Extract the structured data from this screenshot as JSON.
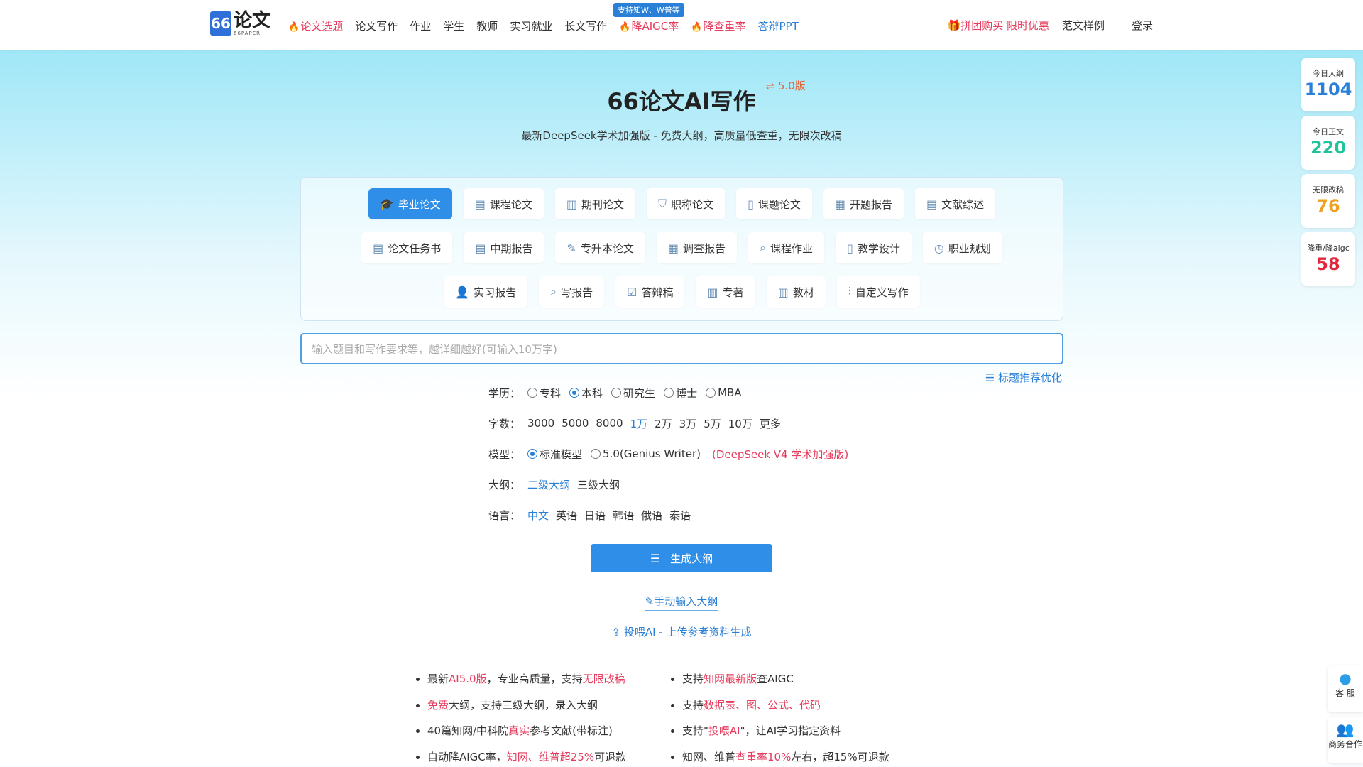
{
  "header": {
    "logo_num": "66",
    "logo_text": "论文",
    "logo_sub": "66PAPER",
    "nav": [
      {
        "label": "论文选题",
        "style": "hot",
        "flame": true
      },
      {
        "label": "论文写作",
        "style": "",
        "flame": false
      },
      {
        "label": "作业",
        "style": "",
        "flame": false
      },
      {
        "label": "学生",
        "style": "",
        "flame": false
      },
      {
        "label": "教师",
        "style": "",
        "flame": false
      },
      {
        "label": "实习就业",
        "style": "",
        "flame": false
      },
      {
        "label": "长文写作",
        "style": "",
        "flame": false
      },
      {
        "label": "降AIGC率",
        "style": "hot",
        "flame": true
      },
      {
        "label": "降查重率",
        "style": "hot",
        "flame": true
      },
      {
        "label": "答辩PPT",
        "style": "blue",
        "flame": false
      }
    ],
    "nav_badge": "支持知W、W普等",
    "promo": "拼团购买 限时优惠",
    "samples": "范文样例",
    "login": "登录"
  },
  "hero": {
    "title": "66论文AI写作",
    "version": "5.0版",
    "subtitle": "最新DeepSeek学术加强版 - 免费大纲，高质量低查重，无限次改稿"
  },
  "types": {
    "row1": [
      {
        "label": "毕业论文",
        "icon": "graduation-cap-icon",
        "glyph": "🎓",
        "active": true
      },
      {
        "label": "课程论文",
        "icon": "document-icon",
        "glyph": "▤",
        "active": false
      },
      {
        "label": "期刊论文",
        "icon": "journal-icon",
        "glyph": "▥",
        "active": false
      },
      {
        "label": "职称论文",
        "icon": "shield-icon",
        "glyph": "⛉",
        "active": false
      },
      {
        "label": "课题论文",
        "icon": "bookmark-icon",
        "glyph": "▯",
        "active": false
      },
      {
        "label": "开题报告",
        "icon": "report-icon",
        "glyph": "▦",
        "active": false
      },
      {
        "label": "文献综述",
        "icon": "document-icon",
        "glyph": "▤",
        "active": false
      }
    ],
    "row2": [
      {
        "label": "论文任务书",
        "icon": "clipboard-icon",
        "glyph": "▤",
        "active": false
      },
      {
        "label": "中期报告",
        "icon": "clipboard-icon",
        "glyph": "▤",
        "active": false
      },
      {
        "label": "专升本论文",
        "icon": "edit-doc-icon",
        "glyph": "✎",
        "active": false
      },
      {
        "label": "调查报告",
        "icon": "survey-icon",
        "glyph": "▦",
        "active": false
      },
      {
        "label": "课程作业",
        "icon": "search-doc-icon",
        "glyph": "⌕",
        "active": false
      },
      {
        "label": "教学设计",
        "icon": "bookmark-icon",
        "glyph": "▯",
        "active": false
      },
      {
        "label": "职业规划",
        "icon": "clock-icon",
        "glyph": "◷",
        "active": false
      }
    ],
    "row3": [
      {
        "label": "实习报告",
        "icon": "user-icon",
        "glyph": "👤",
        "active": false
      },
      {
        "label": "写报告",
        "icon": "search-doc-icon",
        "glyph": "⌕",
        "active": false
      },
      {
        "label": "答辩稿",
        "icon": "checklist-icon",
        "glyph": "☑",
        "active": false
      },
      {
        "label": "专著",
        "icon": "book-icon",
        "glyph": "▥",
        "active": false
      },
      {
        "label": "教材",
        "icon": "book-icon",
        "glyph": "▥",
        "active": false
      },
      {
        "label": "自定义写作",
        "icon": "sliders-icon",
        "glyph": "⫶",
        "active": false
      }
    ]
  },
  "input": {
    "placeholder": "输入题目和写作要求等，越详细越好(可输入10万字)",
    "recommend": "标题推荐优化"
  },
  "options": {
    "education": {
      "label": "学历：",
      "items": [
        {
          "label": "专科",
          "on": false
        },
        {
          "label": "本科",
          "on": true
        },
        {
          "label": "研究生",
          "on": false
        },
        {
          "label": "博士",
          "on": false
        },
        {
          "label": "MBA",
          "on": false
        }
      ]
    },
    "words": {
      "label": "字数：",
      "items": [
        {
          "label": "3000",
          "on": false
        },
        {
          "label": "5000",
          "on": false
        },
        {
          "label": "8000",
          "on": false
        },
        {
          "label": "1万",
          "on": true
        },
        {
          "label": "2万",
          "on": false
        },
        {
          "label": "3万",
          "on": false
        },
        {
          "label": "5万",
          "on": false
        },
        {
          "label": "10万",
          "on": false
        },
        {
          "label": "更多",
          "on": false
        }
      ]
    },
    "model": {
      "label": "模型：",
      "items": [
        {
          "label": "标准模型",
          "on": true
        },
        {
          "label": "5.0(Genius Writer)",
          "on": false
        }
      ],
      "note": "(DeepSeek V4 学术加强版)"
    },
    "outline": {
      "label": "大纲：",
      "items": [
        {
          "label": "二级大纲",
          "on": true
        },
        {
          "label": "三级大纲",
          "on": false
        }
      ]
    },
    "language": {
      "label": "语言：",
      "items": [
        {
          "label": "中文",
          "on": true
        },
        {
          "label": "英语",
          "on": false
        },
        {
          "label": "日语",
          "on": false
        },
        {
          "label": "韩语",
          "on": false
        },
        {
          "label": "俄语",
          "on": false
        },
        {
          "label": "泰语",
          "on": false
        }
      ]
    }
  },
  "actions": {
    "generate": "生成大纲",
    "manual": "手动输入大纲",
    "upload": "投喂AI - 上传参考资料生成"
  },
  "features": {
    "left": [
      [
        {
          "t": "最新"
        },
        {
          "t": "AI5.0版",
          "hl": true
        },
        {
          "t": "，专业高质量，支持"
        },
        {
          "t": "无限改稿",
          "hl": true
        }
      ],
      [
        {
          "t": "免费",
          "hl": true
        },
        {
          "t": "大纲，支持三级大纲，录入大纲"
        }
      ],
      [
        {
          "t": "40篇知网/中科院"
        },
        {
          "t": "真实",
          "hl": true
        },
        {
          "t": "参考文献(带标注)"
        }
      ],
      [
        {
          "t": "自动降AIGC率，"
        },
        {
          "t": "知网、维普超25%",
          "hl": true
        },
        {
          "t": "可退款"
        }
      ]
    ],
    "right": [
      [
        {
          "t": "支持"
        },
        {
          "t": "知网最新版",
          "hl": true
        },
        {
          "t": "查AIGC"
        }
      ],
      [
        {
          "t": "支持"
        },
        {
          "t": "数据表、图、公式、代码",
          "hl": true
        }
      ],
      [
        {
          "t": "支持\""
        },
        {
          "t": "投喂AI",
          "hl": true
        },
        {
          "t": "\"，让AI学习指定资料"
        }
      ],
      [
        {
          "t": "知网、维普"
        },
        {
          "t": "查重率10%",
          "hl": true
        },
        {
          "t": "左右，超15%可退款"
        }
      ]
    ]
  },
  "stats": [
    {
      "label": "今日大纲",
      "value": "1104",
      "color": "#2a7fd6"
    },
    {
      "label": "今日正文",
      "value": "220",
      "color": "#1fc49a"
    },
    {
      "label": "无限改稿",
      "value": "76",
      "color": "#f0a020"
    },
    {
      "label": "降重/降algc",
      "value": "58",
      "color": "#e0283c"
    }
  ],
  "float": {
    "service": "客 服",
    "business": "商务合作"
  }
}
